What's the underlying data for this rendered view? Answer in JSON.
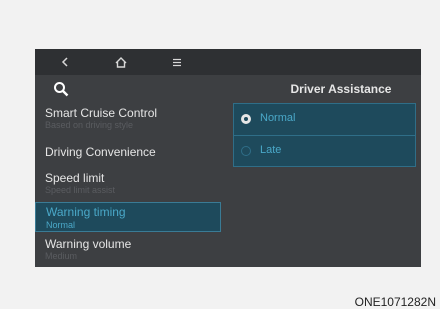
{
  "topbar": {
    "back_icon": "chevron-left-icon",
    "home_icon": "home-icon",
    "menu_icon": "menu-icon"
  },
  "search": {
    "icon": "search-icon"
  },
  "sidebar": {
    "items": [
      {
        "label": "Smart Cruise Control",
        "sub": "Based on driving style"
      },
      {
        "label": "Driving Convenience",
        "sub": ""
      },
      {
        "label": "Speed limit",
        "sub": "Speed limit assist"
      },
      {
        "label": "Warning timing",
        "sub": "Normal"
      },
      {
        "label": "Warning volume",
        "sub": "Medium"
      }
    ]
  },
  "panel": {
    "title": "Driver Assistance",
    "options": [
      {
        "label": "Normal",
        "selected": true
      },
      {
        "label": "Late",
        "selected": false
      }
    ]
  },
  "caption": "ONE1071282N",
  "colors": {
    "accent": "#4aa8c8",
    "highlight_bg": "#1e4a5c"
  }
}
